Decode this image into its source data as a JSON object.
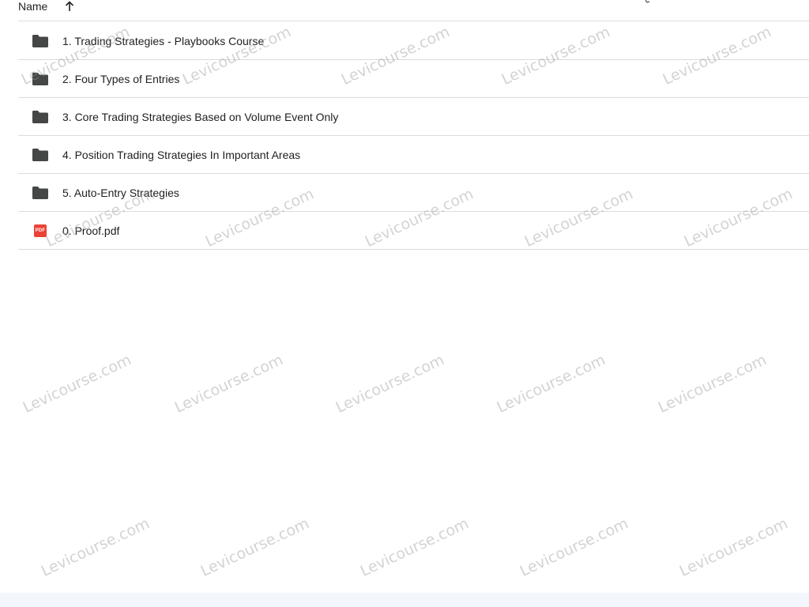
{
  "header": {
    "name_label": "Name",
    "sort_icon": "arrow-upward-icon"
  },
  "files": [
    {
      "type": "folder",
      "icon": "folder-icon",
      "name": "1. Trading Strategies - Playbooks Course"
    },
    {
      "type": "folder",
      "icon": "folder-icon",
      "name": "2. Four Types of Entries"
    },
    {
      "type": "folder",
      "icon": "folder-icon",
      "name": "3. Core Trading Strategies Based on Volume Event Only"
    },
    {
      "type": "folder",
      "icon": "folder-icon",
      "name": "4. Position Trading Strategies In Important Areas"
    },
    {
      "type": "folder",
      "icon": "folder-icon",
      "name": "5. Auto-Entry Strategies"
    },
    {
      "type": "pdf",
      "icon": "pdf-file-icon",
      "badge": "PDF",
      "name": "0. Proof.pdf"
    }
  ],
  "watermark": {
    "text": "Levicourse.com"
  },
  "colors": {
    "folder": "#444746",
    "pdf": "#ea4335",
    "divider": "#dadce0",
    "text": "#1f1f1f"
  }
}
